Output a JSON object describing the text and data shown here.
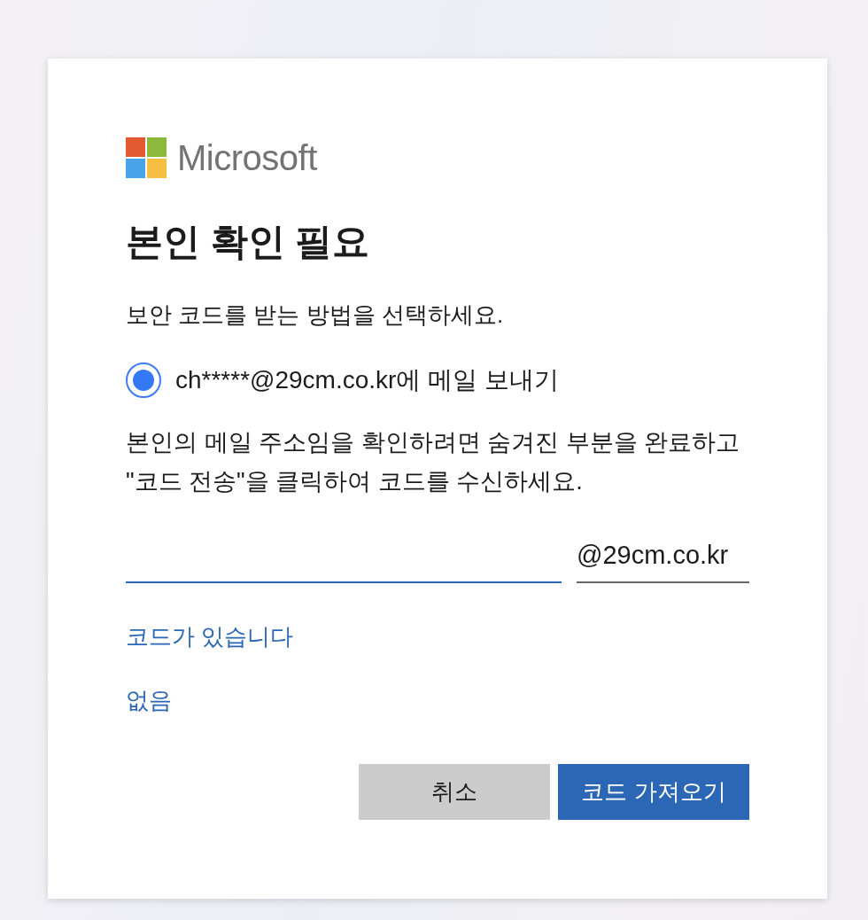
{
  "logo": {
    "text": "Microsoft"
  },
  "title": "본인 확인 필요",
  "subtitle": "보안 코드를 받는 방법을 선택하세요.",
  "options": [
    {
      "label": "ch*****@29cm.co.kr에 메일 보내기",
      "selected": true
    }
  ],
  "instructions": "본인의 메일 주소임을 확인하려면 숨겨진 부분을 완료하고 \"코드 전송\"을 클릭하여 코드를 수신하세요.",
  "email_field": {
    "focused": true,
    "suffix": "@29cm.co.kr"
  },
  "links": [
    "코드가 있습니다",
    "없음"
  ],
  "buttons": [
    {
      "label": "취소",
      "kind": "secondary"
    },
    {
      "label": "코드 가져오기",
      "kind": "primary"
    }
  ]
}
